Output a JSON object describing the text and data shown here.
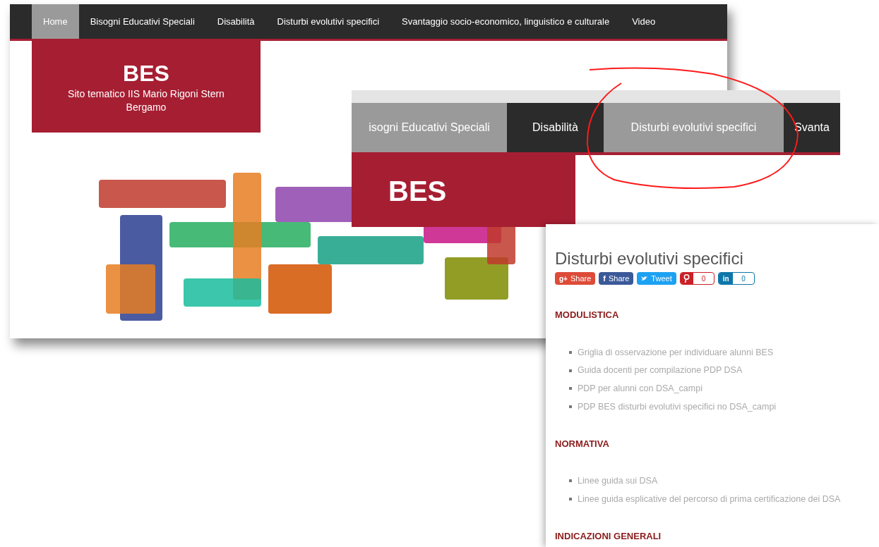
{
  "main_page": {
    "nav": [
      {
        "label": "Home",
        "selected": true
      },
      {
        "label": "Bisogni Educativi Speciali",
        "selected": false
      },
      {
        "label": "Disabilità",
        "selected": false
      },
      {
        "label": "Disturbi evolutivi specifici",
        "selected": false
      },
      {
        "label": "Svantaggio socio-economico, linguistico e culturale",
        "selected": false
      },
      {
        "label": "Video",
        "selected": false
      }
    ],
    "brand": {
      "title": "BES",
      "subtitle": "Sito tematico IIS Mario Rigoni Stern Bergamo"
    }
  },
  "zoomed_nav": {
    "nav": [
      {
        "label": "isogni Educativi Speciali",
        "selected": true
      },
      {
        "label": "Disabilità",
        "selected": false
      },
      {
        "label": "Disturbi evolutivi specifici",
        "selected": true
      },
      {
        "label": "Svanta",
        "selected": false
      }
    ],
    "brand": {
      "title": "BES"
    },
    "annotation": {
      "kind": "ellipse",
      "color": "#ff1a1a"
    }
  },
  "article": {
    "title": "Disturbi evolutivi specifici",
    "share": [
      {
        "kind": "googleplus",
        "icon": "g+",
        "label": "Share"
      },
      {
        "kind": "facebook",
        "icon": "f",
        "label": "Share"
      },
      {
        "kind": "twitter",
        "label": "Tweet"
      },
      {
        "kind": "pinterest",
        "count": "0"
      },
      {
        "kind": "linkedin",
        "icon": "in",
        "count": "0"
      }
    ],
    "sections": [
      {
        "heading": "MODULISTICA",
        "items": [
          "Griglia di osservazione per individuare alunni BES",
          "Guida docenti per compilazione PDP DSA",
          "PDP per alunni con DSA_campi",
          "PDP BES disturbi evolutivi specifici no DSA_campi"
        ]
      },
      {
        "heading": "NORMATIVA",
        "items": [
          "Linee guida sui DSA",
          "Linee guida esplicative del percorso di prima certificazione dei DSA"
        ]
      },
      {
        "heading": "INDICAZIONI GENERALI"
      }
    ]
  }
}
